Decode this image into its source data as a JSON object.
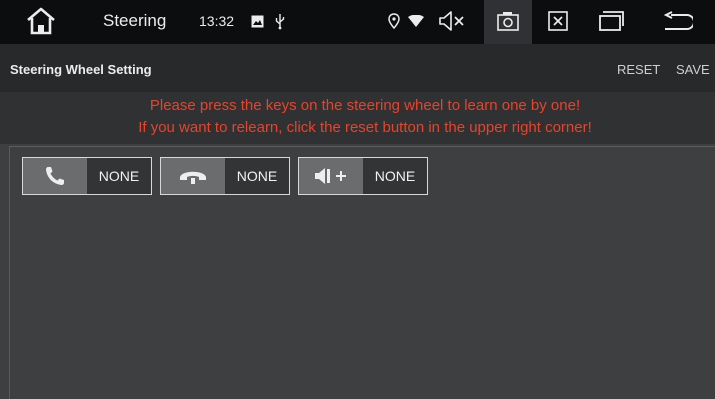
{
  "status_bar": {
    "app_title": "Steering",
    "time": "13:32",
    "icons": [
      "home-icon",
      "gallery-icon",
      "usb-icon",
      "location-icon",
      "wifi-icon",
      "volume-mute-icon",
      "screenshot-icon",
      "close-window-icon",
      "recent-apps-icon",
      "back-icon"
    ]
  },
  "header": {
    "title": "Steering Wheel Setting",
    "reset_label": "RESET",
    "save_label": "SAVE"
  },
  "notice": {
    "line1": "Please press the keys on the steering wheel to learn one by one!",
    "line2": "If you want to relearn, click the reset button in the upper right corner!",
    "color": "#e8432b"
  },
  "keys": [
    {
      "icon": "phone-answer-icon",
      "value": "NONE"
    },
    {
      "icon": "phone-hangup-icon",
      "value": "NONE"
    },
    {
      "icon": "volume-up-icon",
      "value": "NONE"
    }
  ]
}
